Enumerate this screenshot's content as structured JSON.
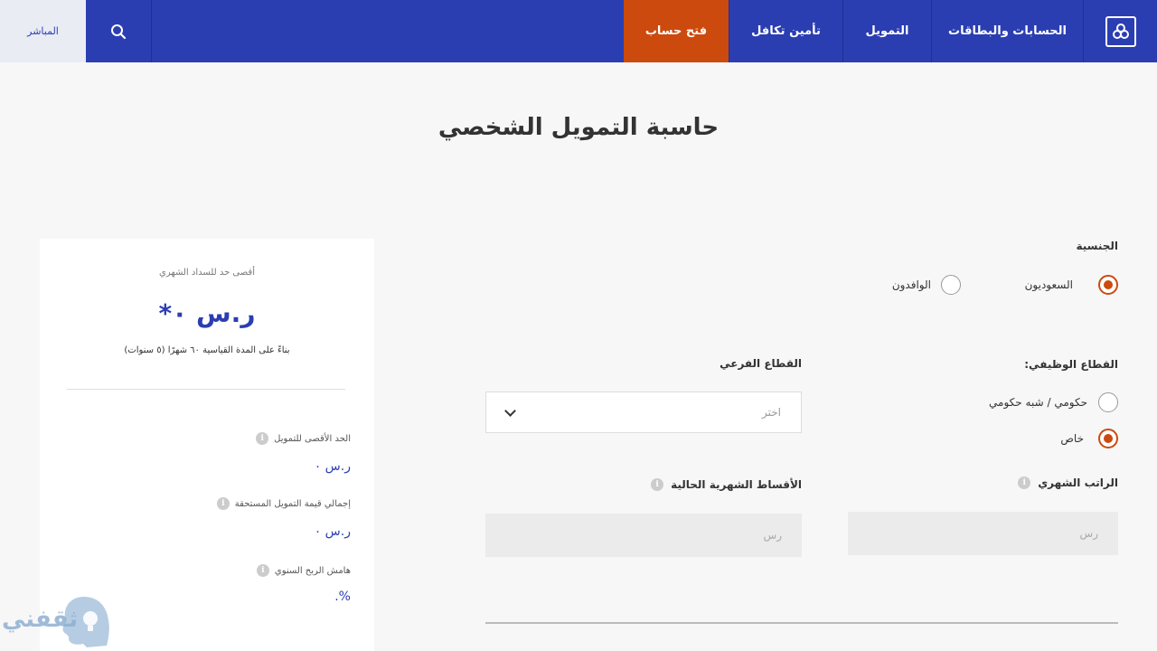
{
  "nav": {
    "accounts": "الحسابات والبطاقات",
    "finance": "التمويل",
    "takaful": "تأمين تكافل",
    "open_account": "فتح حساب",
    "direct": "المباشر"
  },
  "page": {
    "title": "حاسبة التمويل الشخصي"
  },
  "summary": {
    "max_payment_label": "أقصى حد للسداد الشهري",
    "max_payment_value": "ر.س ٠*",
    "duration_note": "بناءً على المدة القياسية ٦٠ شهرًا (٥ سنوات)",
    "max_finance_label": "الحد الأقصى للتمويل",
    "max_finance_value": "ر.س ٠",
    "total_due_label": "إجمالي قيمة التمويل المستحقة",
    "total_due_value": "ر.س ٠",
    "profit_margin_label": "هامش الربح السنوي",
    "profit_margin_value": "%."
  },
  "form": {
    "nationality_label": "الجنسية",
    "nationality_options": [
      "السعوديون",
      "الوافدون"
    ],
    "nationality_selected": 0,
    "sector_label": "القطاع الوظيفي:",
    "sector_options": [
      "حكومي / شبه حكومي",
      "خاص"
    ],
    "sector_selected": 1,
    "subsector_label": "القطاع الفرعي",
    "subsector_placeholder": "اختر",
    "salary_label": "الراتب الشهري",
    "salary_placeholder": "رس",
    "installments_label": "الأقساط الشهرية الحالية",
    "installments_placeholder": "رس"
  },
  "watermark": {
    "text": "ثقفني"
  },
  "colors": {
    "nav_bg": "#2b3eb1",
    "accent": "#cc4a0e",
    "amount_text": "#2b3eb1"
  }
}
